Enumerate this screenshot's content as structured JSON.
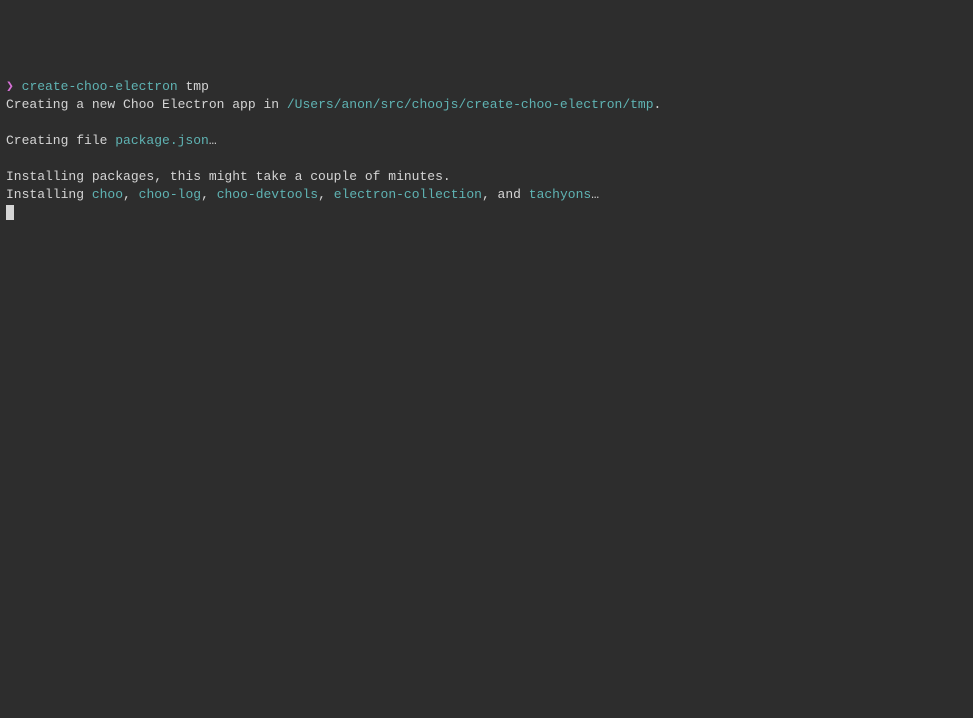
{
  "prompt_symbol": "❯",
  "command": "create-choo-electron",
  "arg": "tmp",
  "line2_prefix": "Creating a new Choo Electron app in ",
  "line2_path": "/Users/anon/src/choojs/create-choo-electron/tmp",
  "line2_suffix": ".",
  "line4_prefix": "Creating file ",
  "line4_file": "package.json",
  "line4_suffix": "…",
  "line6": "Installing packages, this might take a couple of minutes.",
  "line7_prefix": "Installing ",
  "pkg1": "choo",
  "sep1": ", ",
  "pkg2": "choo-log",
  "sep2": ", ",
  "pkg3": "choo-devtools",
  "sep3": ", ",
  "pkg4": "electron-collection",
  "sep4": ", and ",
  "pkg5": "tachyons",
  "line7_suffix": "…"
}
